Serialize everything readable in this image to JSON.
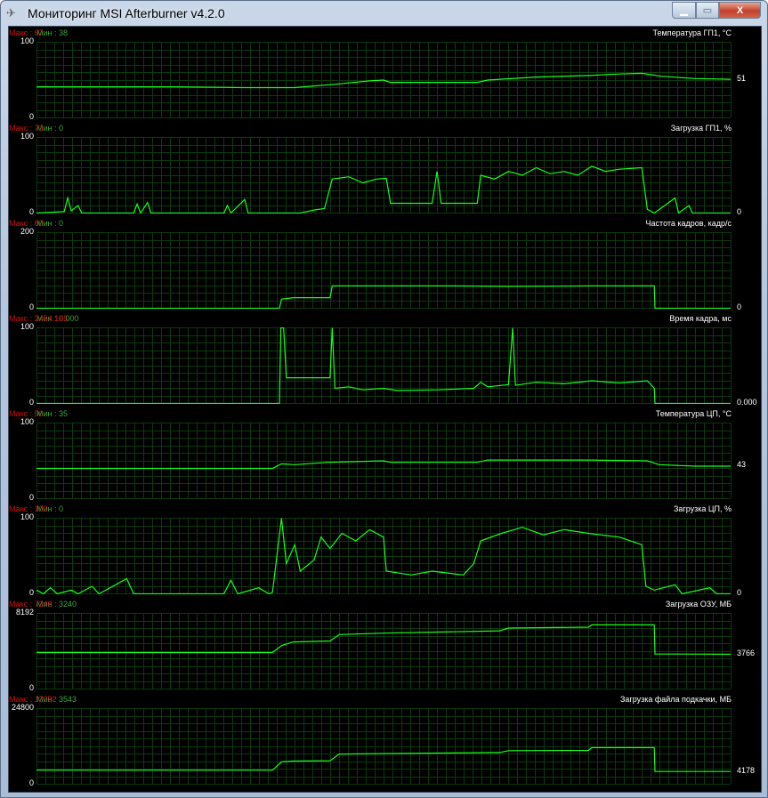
{
  "window": {
    "title": "Мониторинг MSI Afterburner v4.2.0",
    "app_icon": "afterburner-icon",
    "minimize": "▁",
    "maximize": "▭",
    "close": "X"
  },
  "colors": {
    "line": "#19ff19",
    "grid": "#0c3a0c",
    "min": "#3aa33a",
    "max": "#c81414"
  },
  "x_unit": "percent of time window",
  "graphs": [
    {
      "name": "Температура ГП1, °C",
      "min_label": "Мин : 38",
      "max_label": "Макс : 67",
      "y_top": "100",
      "y_bottom": "0",
      "ymax": 100,
      "current": "51",
      "points": [
        [
          0,
          41
        ],
        [
          20,
          41
        ],
        [
          30,
          40
        ],
        [
          37.2,
          40
        ],
        [
          43.6,
          45
        ],
        [
          48,
          49
        ],
        [
          50,
          50
        ],
        [
          51,
          47
        ],
        [
          63.5,
          47
        ],
        [
          65,
          50
        ],
        [
          72,
          54
        ],
        [
          79.5,
          56
        ],
        [
          84,
          58
        ],
        [
          87.2,
          59
        ],
        [
          90,
          55
        ],
        [
          94.9,
          52
        ],
        [
          100,
          51
        ]
      ]
    },
    {
      "name": "Загрузка ГП1, %",
      "min_label": "Мин : 0",
      "max_label": "Макс : 73",
      "y_top": "100",
      "y_bottom": "0",
      "ymax": 100,
      "current": "0",
      "points": [
        [
          0,
          0
        ],
        [
          4,
          2
        ],
        [
          4.5,
          20
        ],
        [
          5,
          3
        ],
        [
          6,
          10
        ],
        [
          6.5,
          0
        ],
        [
          14,
          0
        ],
        [
          14.5,
          12
        ],
        [
          15,
          0
        ],
        [
          16,
          14
        ],
        [
          16.5,
          0
        ],
        [
          27,
          0
        ],
        [
          27.5,
          10
        ],
        [
          28,
          0
        ],
        [
          30,
          18
        ],
        [
          30.5,
          0
        ],
        [
          38,
          0
        ],
        [
          40,
          4
        ],
        [
          41.5,
          6
        ],
        [
          42.6,
          45
        ],
        [
          45,
          48
        ],
        [
          47,
          40
        ],
        [
          49,
          45
        ],
        [
          50.4,
          46
        ],
        [
          51,
          13
        ],
        [
          57,
          13
        ],
        [
          57.7,
          55
        ],
        [
          58.3,
          13
        ],
        [
          63.5,
          13
        ],
        [
          64,
          50
        ],
        [
          66,
          45
        ],
        [
          68,
          55
        ],
        [
          70,
          50
        ],
        [
          72,
          60
        ],
        [
          74,
          52
        ],
        [
          76,
          55
        ],
        [
          78,
          50
        ],
        [
          80,
          62
        ],
        [
          82,
          55
        ],
        [
          84,
          58
        ],
        [
          87.2,
          60
        ],
        [
          88,
          5
        ],
        [
          89,
          0
        ],
        [
          92,
          20
        ],
        [
          92.5,
          0
        ],
        [
          94,
          10
        ],
        [
          94.5,
          0
        ],
        [
          100,
          0
        ]
      ]
    },
    {
      "name": "Частота кадров, кадр/с",
      "min_label": "Мин : 0",
      "max_label": "Макс : 60",
      "y_top": "200",
      "y_bottom": "0",
      "ymax": 200,
      "current": "0",
      "points": [
        [
          0,
          0
        ],
        [
          35,
          0
        ],
        [
          35.3,
          24
        ],
        [
          37,
          28
        ],
        [
          42.3,
          28
        ],
        [
          42.6,
          59
        ],
        [
          60,
          59
        ],
        [
          68,
          58
        ],
        [
          80,
          59
        ],
        [
          89,
          59
        ],
        [
          89.1,
          0
        ],
        [
          100,
          0
        ]
      ]
    },
    {
      "name": "Время кадра, мс",
      "min_label": "Мин : 0.000",
      "max_label": "Макс : 2454.195",
      "y_top": "100",
      "y_bottom": "0",
      "ymax": 100,
      "current": "0.000",
      "points": [
        [
          0,
          0
        ],
        [
          35,
          0
        ],
        [
          35.2,
          100
        ],
        [
          35.6,
          100
        ],
        [
          36,
          34
        ],
        [
          38,
          34
        ],
        [
          42.3,
          34
        ],
        [
          42.6,
          100
        ],
        [
          43,
          20
        ],
        [
          45,
          22
        ],
        [
          47,
          18
        ],
        [
          50,
          20
        ],
        [
          52,
          17
        ],
        [
          58,
          18
        ],
        [
          63,
          20
        ],
        [
          64,
          28
        ],
        [
          65,
          22
        ],
        [
          68,
          25
        ],
        [
          68.6,
          100
        ],
        [
          69,
          24
        ],
        [
          72,
          28
        ],
        [
          76,
          26
        ],
        [
          80,
          30
        ],
        [
          84,
          27
        ],
        [
          88,
          30
        ],
        [
          89,
          20
        ],
        [
          89.1,
          0
        ],
        [
          100,
          0
        ]
      ]
    },
    {
      "name": "Температура ЦП, °C",
      "min_label": "Мин : 35",
      "max_label": "Макс : 56",
      "y_top": "100",
      "y_bottom": "0",
      "ymax": 100,
      "current": "43",
      "points": [
        [
          0,
          40
        ],
        [
          10,
          40
        ],
        [
          20,
          40
        ],
        [
          34,
          40
        ],
        [
          35.3,
          46
        ],
        [
          37.2,
          45
        ],
        [
          42,
          48
        ],
        [
          50,
          50
        ],
        [
          51,
          48
        ],
        [
          63.5,
          48
        ],
        [
          65,
          51
        ],
        [
          79.5,
          51
        ],
        [
          88,
          50
        ],
        [
          89.7,
          45
        ],
        [
          94.9,
          43
        ],
        [
          100,
          43
        ]
      ]
    },
    {
      "name": "Загрузка ЦП, %",
      "min_label": "Мин : 0",
      "max_label": "Макс : 100",
      "y_top": "100",
      "y_bottom": "0",
      "ymax": 100,
      "current": "0",
      "points": [
        [
          0,
          5
        ],
        [
          1,
          0
        ],
        [
          2,
          8
        ],
        [
          3,
          0
        ],
        [
          5,
          5
        ],
        [
          6,
          0
        ],
        [
          8,
          10
        ],
        [
          9,
          0
        ],
        [
          13,
          20
        ],
        [
          14,
          0
        ],
        [
          21,
          0
        ],
        [
          27,
          0
        ],
        [
          28,
          18
        ],
        [
          29,
          0
        ],
        [
          32,
          8
        ],
        [
          33.5,
          0
        ],
        [
          34,
          2
        ],
        [
          35.3,
          100
        ],
        [
          36,
          40
        ],
        [
          37.2,
          65
        ],
        [
          38,
          30
        ],
        [
          40,
          45
        ],
        [
          41,
          75
        ],
        [
          42.3,
          60
        ],
        [
          44,
          80
        ],
        [
          46,
          70
        ],
        [
          48,
          85
        ],
        [
          50,
          75
        ],
        [
          50.4,
          30
        ],
        [
          54,
          25
        ],
        [
          57,
          30
        ],
        [
          61.5,
          25
        ],
        [
          63,
          40
        ],
        [
          64,
          70
        ],
        [
          67,
          80
        ],
        [
          70,
          88
        ],
        [
          73,
          78
        ],
        [
          76,
          85
        ],
        [
          79.5,
          80
        ],
        [
          84,
          75
        ],
        [
          87.2,
          65
        ],
        [
          87.8,
          10
        ],
        [
          89,
          5
        ],
        [
          92,
          12
        ],
        [
          93,
          0
        ],
        [
          97,
          8
        ],
        [
          98,
          0
        ],
        [
          100,
          0
        ]
      ]
    },
    {
      "name": "Загрузка ОЗУ, МБ",
      "min_label": "Мин : 3240",
      "max_label": "Макс : 7248",
      "y_top": "8192",
      "y_bottom": "0",
      "ymax": 8192,
      "current": "3766",
      "points": [
        [
          0,
          3950
        ],
        [
          34,
          3950
        ],
        [
          35.3,
          4700
        ],
        [
          37,
          5100
        ],
        [
          42.3,
          5200
        ],
        [
          43.6,
          5900
        ],
        [
          50,
          6050
        ],
        [
          66.7,
          6300
        ],
        [
          68,
          6600
        ],
        [
          79.5,
          6700
        ],
        [
          80,
          6950
        ],
        [
          89,
          6950
        ],
        [
          89.1,
          3800
        ],
        [
          100,
          3766
        ]
      ]
    },
    {
      "name": "Загрузка файла подкачки, МБ",
      "min_label": "Мин : 3543",
      "max_label": "Макс : 12252",
      "y_top": "24800",
      "y_bottom": "0",
      "ymax": 24800,
      "current": "4178",
      "points": [
        [
          0,
          4600
        ],
        [
          34,
          4600
        ],
        [
          35.3,
          7300
        ],
        [
          37,
          7600
        ],
        [
          42.3,
          7700
        ],
        [
          43.6,
          9900
        ],
        [
          66.7,
          10400
        ],
        [
          68,
          11000
        ],
        [
          79.5,
          11100
        ],
        [
          80,
          12000
        ],
        [
          89,
          12000
        ],
        [
          89.1,
          4178
        ],
        [
          100,
          4178
        ]
      ]
    }
  ]
}
